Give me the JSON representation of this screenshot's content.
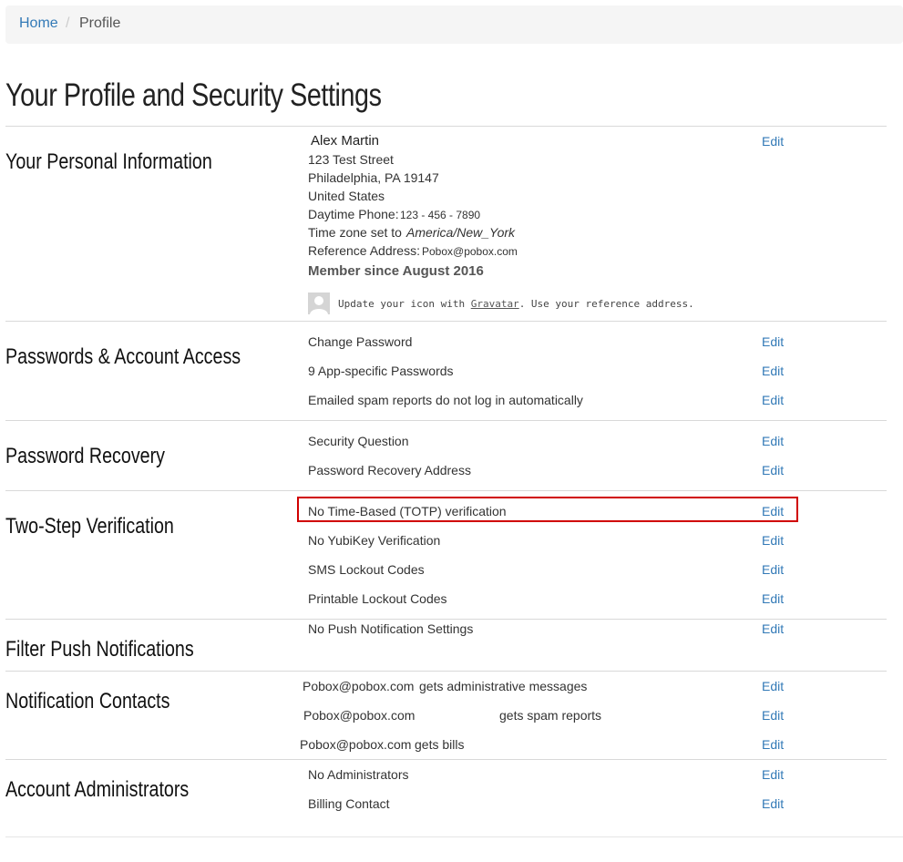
{
  "breadcrumb": {
    "home": "Home",
    "separator": "/",
    "current": "Profile"
  },
  "page_title": "Your Profile and Security Settings",
  "edit_label": "Edit",
  "personal": {
    "title": "Your Personal Information",
    "name": "Alex Martin",
    "street": "123 Test Street",
    "city": "Philadelphia, PA 19147",
    "country": "United States",
    "phone_label": "Daytime Phone:",
    "phone_value": "123 - 456 - 7890",
    "tz_label": "Time zone set to ",
    "tz_value": "America/New_York",
    "ref_label": "Reference Address:",
    "ref_value": "Pobox@pobox.com",
    "member_since": "Member since August 2016",
    "gravatar_pre": "Update your icon with ",
    "gravatar_link": "Gravatar",
    "gravatar_post": ". Use your reference address."
  },
  "passwords": {
    "title": "Passwords & Account Access",
    "items": [
      "Change Password",
      "9 App-specific Passwords",
      "Emailed spam reports do not log in automatically"
    ]
  },
  "recovery": {
    "title": "Password Recovery",
    "items": [
      "Security Question",
      "Password Recovery Address"
    ]
  },
  "two_step": {
    "title": "Two-Step Verification",
    "items": [
      "No Time-Based (TOTP) verification",
      "No YubiKey Verification",
      "SMS Lockout Codes",
      "Printable Lockout Codes"
    ]
  },
  "push": {
    "title": "Filter Push Notifications",
    "items": [
      "No Push Notification Settings"
    ]
  },
  "contacts": {
    "title": "Notification Contacts",
    "rows": [
      {
        "email": "Pobox@pobox.com",
        "desc": "gets administrative messages"
      },
      {
        "email": "Pobox@pobox.com",
        "desc": "gets spam reports"
      },
      {
        "email": "Pobox@pobox.com",
        "desc": "gets bills"
      }
    ]
  },
  "admins": {
    "title": "Account Administrators",
    "items": [
      "No Administrators",
      "Billing Contact"
    ]
  },
  "colors": {
    "link": "#337ab7",
    "highlight": "#d00000"
  }
}
